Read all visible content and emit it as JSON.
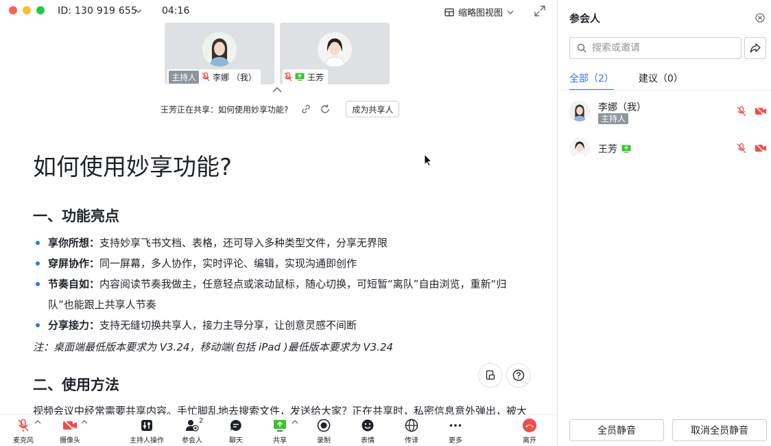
{
  "titlebar": {
    "meeting_id": "ID: 130 919 655",
    "timer": "04:16",
    "view_mode": "缩略图视图"
  },
  "thumbnails": [
    {
      "host_tag": "主持人",
      "name": "李娜 （我）",
      "mic": "muted"
    },
    {
      "name": "王芳",
      "mic": "muted",
      "sharing": true
    }
  ],
  "share_bar": {
    "text": "王芳正在共享：如何使用妙享功能?",
    "become_sharer": "成为共享人"
  },
  "document": {
    "title": "如何使用妙享功能?",
    "section1": {
      "heading": "一、功能亮点",
      "items": [
        {
          "bold": "享你所想：",
          "text": "支持妙享飞书文档、表格，还可导入多种类型文件，分享无界限"
        },
        {
          "bold": "穿屏协作：",
          "text": "同一屏幕，多人协作，实时评论、编辑，实现沟通即创作"
        },
        {
          "bold": "节奏自如：",
          "text": "内容阅读节奏我做主，任意轻点或滚动鼠标，随心切换，可短暂“离队”自由浏览，重新“归队”也能跟上共享人节奏"
        },
        {
          "bold": "分享接力：",
          "text": "支持无缝切换共享人，接力主导分享，让创意灵感不间断"
        }
      ],
      "note": "注：桌面端最低版本要求为 V3.24，移动端(包括 iPad )最低版本要求为 V3.24"
    },
    "section2": {
      "heading": "二、使用方法",
      "paragraph": "视频会议中经常需要共享内容。手忙脚乱地去搜索文件，发送给大家？正在共享时，私密信息意外弹出，被大家看到？边开视频会议，边在多个窗口间切换操作？别人共享的内容，各种看不清听不明？"
    }
  },
  "toolbar": {
    "mic": "麦克风",
    "camera": "摄像头",
    "host_ops": "主持人操作",
    "participants": "参会人",
    "participants_count": "2",
    "chat": "聊天",
    "share": "共享",
    "record": "录制",
    "reactions": "表情",
    "translate": "传译",
    "more": "更多",
    "leave": "离开"
  },
  "sidebar": {
    "title": "参会人",
    "search_placeholder": "搜索或邀请",
    "tabs": [
      {
        "label": "全部（2）",
        "active": true
      },
      {
        "label": "建议（0）",
        "active": false
      }
    ],
    "participants": [
      {
        "name": "李娜（我）",
        "host_tag": "主持人",
        "mic": "muted",
        "camera": "off"
      },
      {
        "name": "王芳",
        "sharing": true,
        "mic": "muted",
        "camera": "off"
      }
    ],
    "mute_all": "全员静音",
    "unmute_all": "取消全员静音"
  },
  "colors": {
    "accent": "#3370ff",
    "muted_red": "#f54a45",
    "share_green": "#34c724",
    "host_tag_bg": "#8f959e"
  }
}
